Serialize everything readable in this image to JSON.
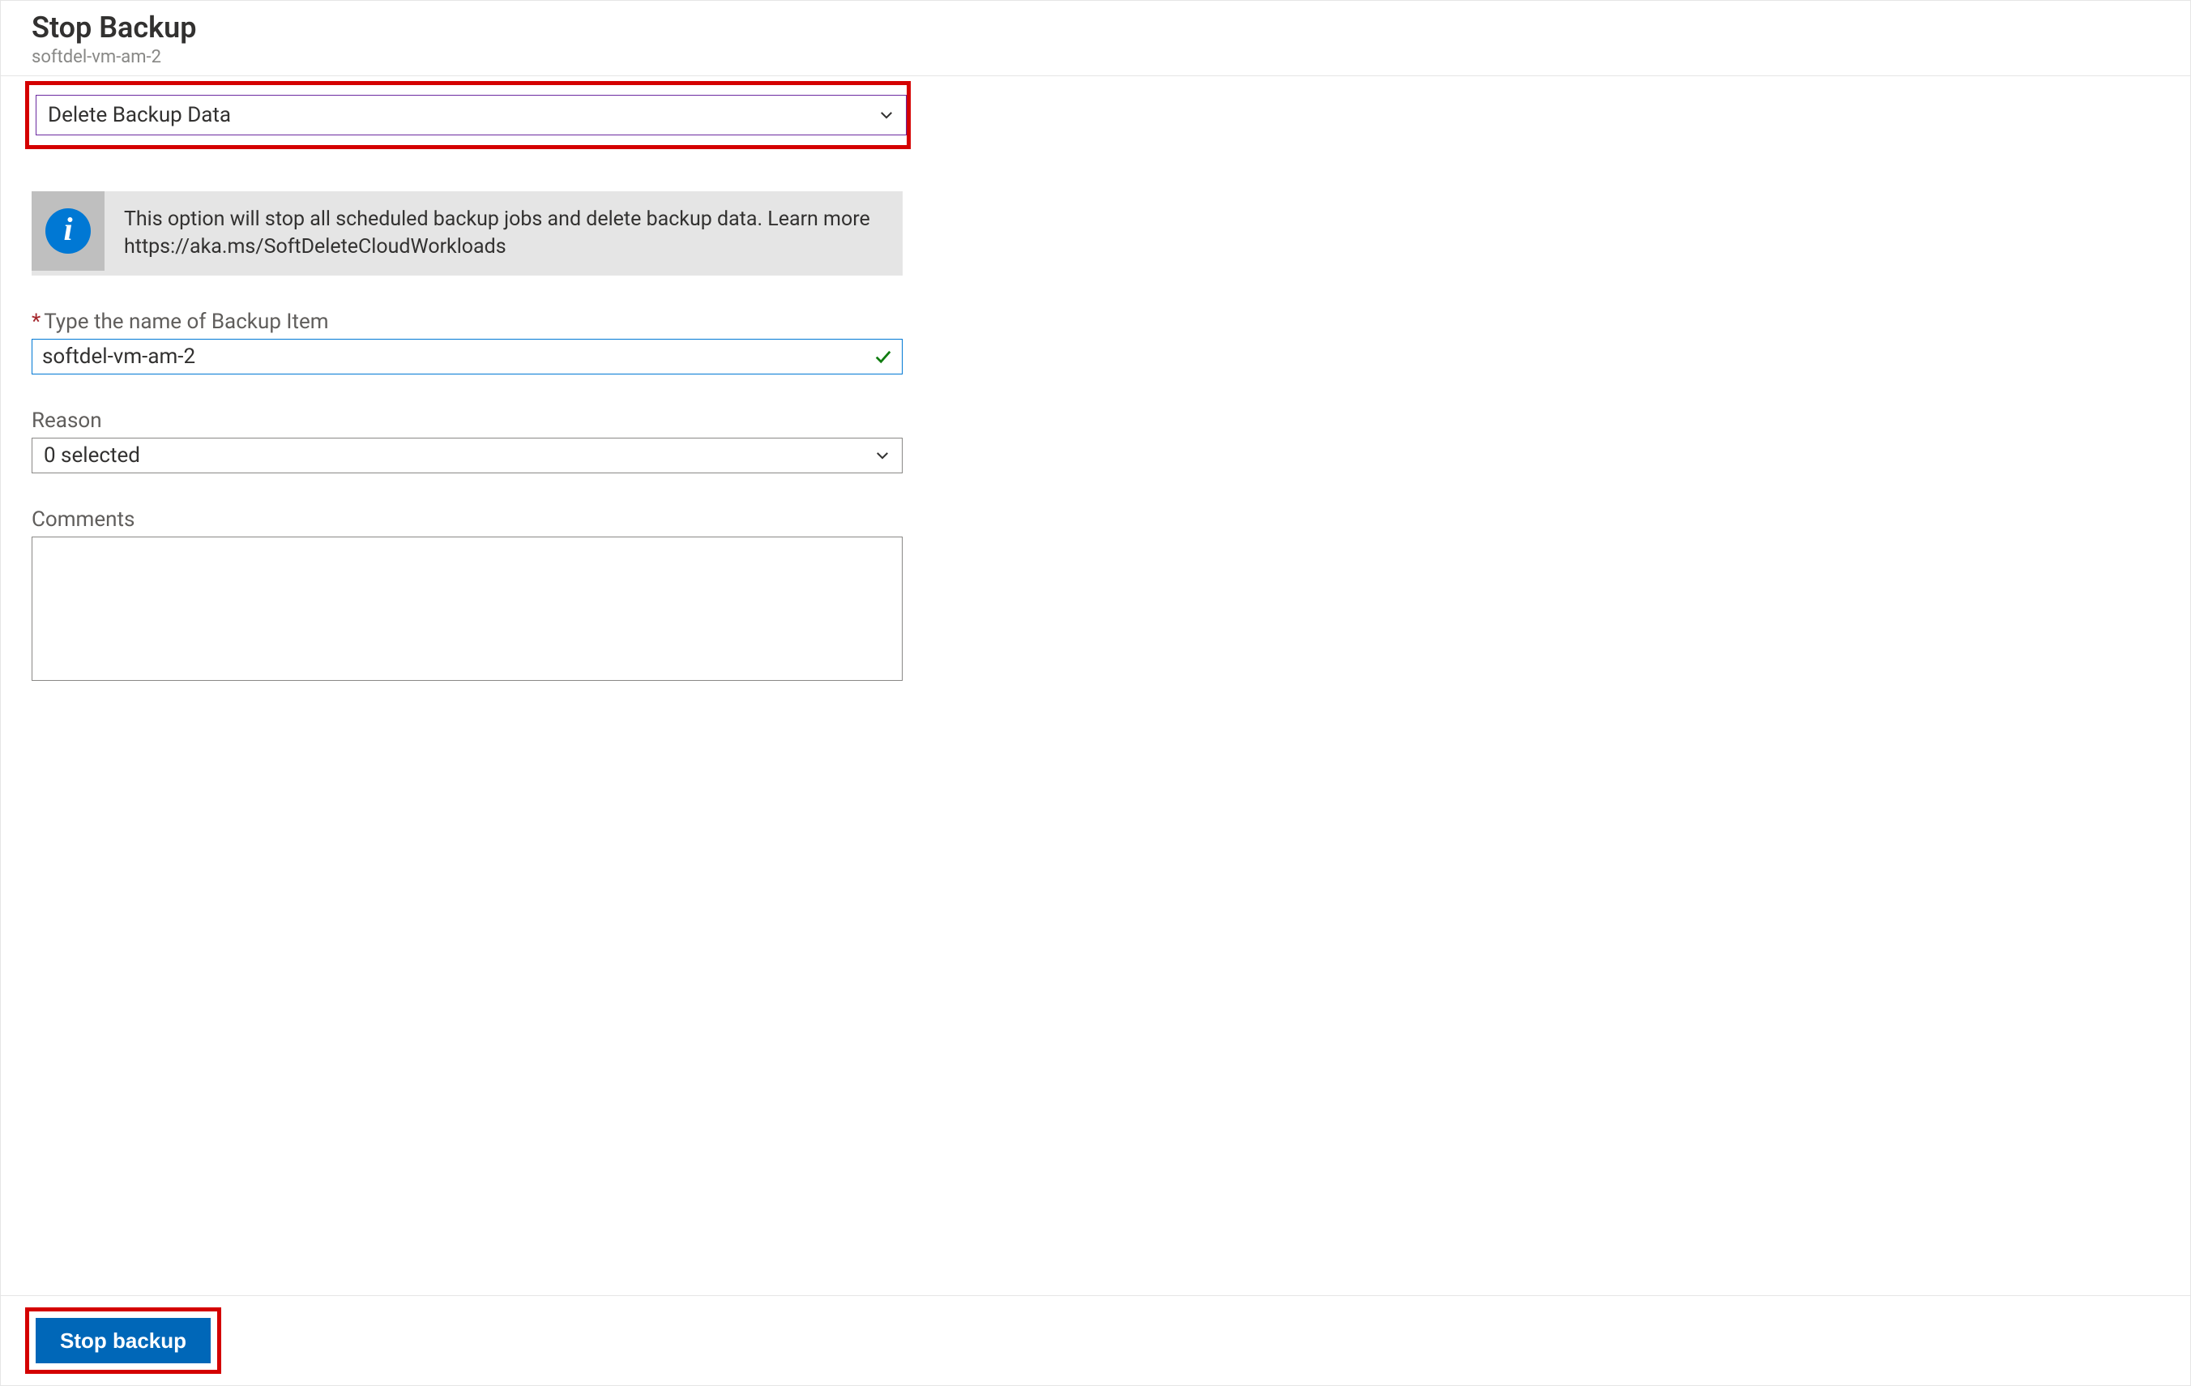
{
  "header": {
    "title": "Stop Backup",
    "subtitle": "softdel-vm-am-2"
  },
  "action_dropdown": {
    "selected": "Delete Backup Data"
  },
  "info": {
    "message": "This option will stop all scheduled backup jobs and delete backup data. Learn more https://aka.ms/SoftDeleteCloudWorkloads"
  },
  "fields": {
    "backup_item_name": {
      "label": "Type the name of Backup Item",
      "value": "softdel-vm-am-2",
      "valid": true
    },
    "reason": {
      "label": "Reason",
      "selected": "0 selected"
    },
    "comments": {
      "label": "Comments",
      "value": ""
    }
  },
  "footer": {
    "submit_label": "Stop backup"
  }
}
